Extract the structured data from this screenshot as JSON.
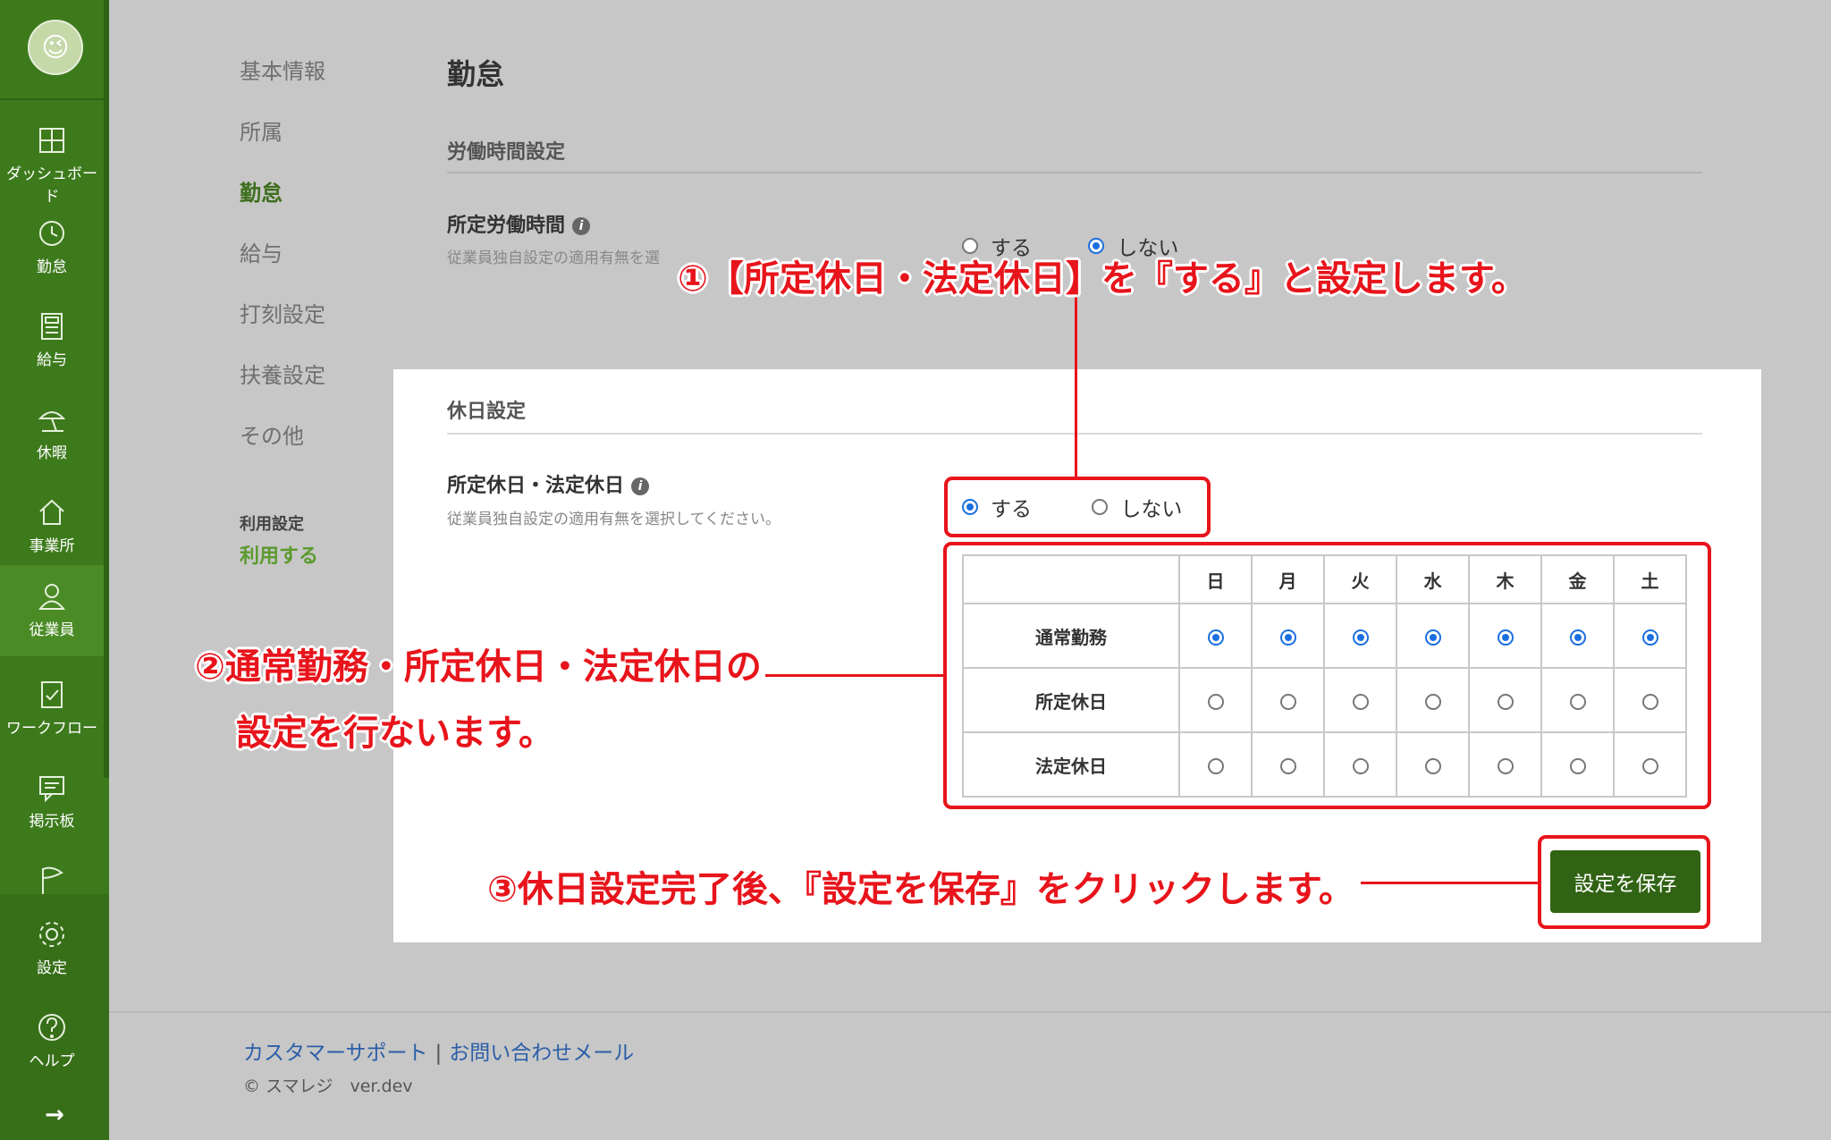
{
  "sidebar": {
    "items": [
      {
        "label": "ダッシュボード",
        "icon": "dashboard-icon"
      },
      {
        "label": "勤怠",
        "icon": "clock-icon"
      },
      {
        "label": "給与",
        "icon": "calculator-icon"
      },
      {
        "label": "休暇",
        "icon": "beach-umbrella-icon"
      },
      {
        "label": "事業所",
        "icon": "home-icon"
      },
      {
        "label": "従業員",
        "icon": "person-icon"
      },
      {
        "label": "ワークフロー",
        "icon": "checklist-icon"
      },
      {
        "label": "掲示板",
        "icon": "message-icon"
      },
      {
        "label": "",
        "icon": "flag-icon"
      },
      {
        "label": "設定",
        "icon": "gear-icon"
      },
      {
        "label": "ヘルプ",
        "icon": "help-icon"
      }
    ],
    "arrow": "→"
  },
  "subnav": {
    "items": [
      "基本情報",
      "所属",
      "勤怠",
      "給与",
      "打刻設定",
      "扶養設定",
      "その他"
    ],
    "usage_label": "利用設定",
    "usage_value": "利用する"
  },
  "page": {
    "title": "勤怠",
    "work_hours": {
      "section": "労働時間設定",
      "label": "所定労働時間",
      "help": "従業員独自設定の適用有無を選",
      "opt_yes": "する",
      "opt_no": "しない",
      "selected": "しない"
    },
    "holiday": {
      "section": "休日設定",
      "label": "所定休日・法定休日",
      "help": "従業員独自設定の適用有無を選択してください。",
      "opt_yes": "する",
      "opt_no": "しない",
      "selected": "する",
      "days": [
        "日",
        "月",
        "火",
        "水",
        "木",
        "金",
        "土"
      ],
      "rows": [
        {
          "label": "通常勤務",
          "selected": [
            true,
            true,
            true,
            true,
            true,
            true,
            true
          ]
        },
        {
          "label": "所定休日",
          "selected": [
            false,
            false,
            false,
            false,
            false,
            false,
            false
          ]
        },
        {
          "label": "法定休日",
          "selected": [
            false,
            false,
            false,
            false,
            false,
            false,
            false
          ]
        }
      ]
    },
    "save_label": "設定を保存"
  },
  "annotations": {
    "step1": "①【所定休日・法定休日】を『する』と設定します。",
    "step2_line1": "②通常勤務・所定休日・法定休日の",
    "step2_line2": "設定を行ないます。",
    "step3": "③休日設定完了後、『設定を保存』をクリックします。",
    "color": "#e8141b"
  },
  "footer": {
    "support": "カスタマーサポート",
    "separator": "|",
    "contact": "お問い合わせメール",
    "copyright": "© スマレジ　ver.dev"
  }
}
